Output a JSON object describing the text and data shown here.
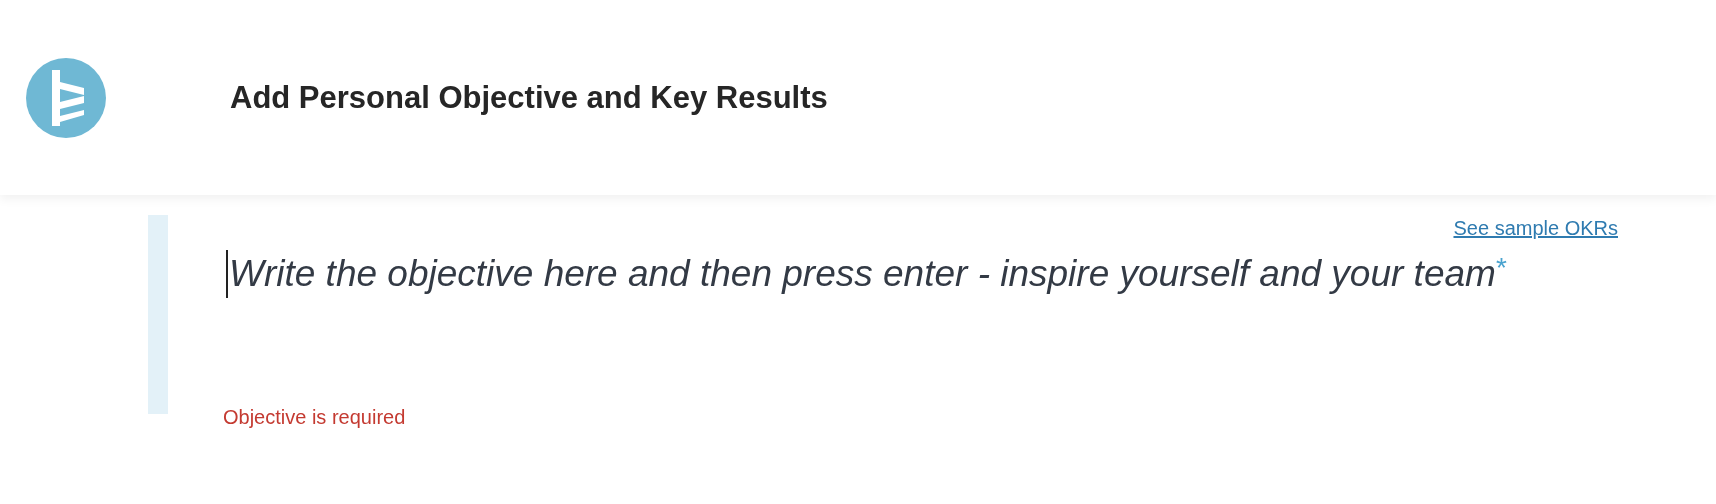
{
  "header": {
    "title": "Add Personal Objective and Key Results"
  },
  "sample_link": "See sample OKRs",
  "objective_field": {
    "placeholder": "Write the objective here and then press enter - inspire yourself and your team",
    "required_mark": "*"
  },
  "error": "Objective is required"
}
